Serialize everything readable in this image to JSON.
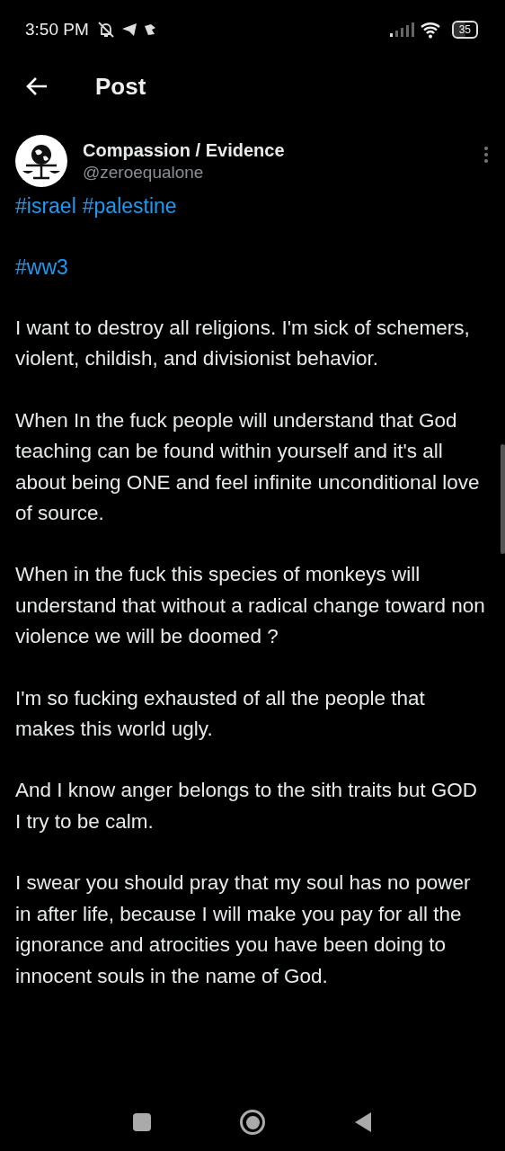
{
  "status_bar": {
    "time": "3:50 PM",
    "battery": "35"
  },
  "header": {
    "title": "Post"
  },
  "post": {
    "author": "Compassion / Evidence",
    "handle": "@zeroequalone",
    "hashtag_lines": [
      [
        "#israel",
        "#palestine"
      ],
      [
        "#ww3"
      ]
    ],
    "paragraphs": [
      "I want to destroy all religions. I'm sick of schemers, violent, childish, and divisionist behavior.",
      "When In the fuck people will understand that God teaching can be found within yourself and it's all about being ONE and feel infinite unconditional love of source.",
      "When in the fuck this species of monkeys will understand that without a radical change toward non violence we will be doomed ?",
      "I'm so fucking exhausted of all the people that makes this world ugly.",
      "And I know anger belongs to the sith traits but GOD I try to be calm.",
      "I swear you should pray that my soul has no power in after life, because I will make you pay for all the ignorance and atrocities you have been doing to innocent souls in the name of God."
    ]
  }
}
